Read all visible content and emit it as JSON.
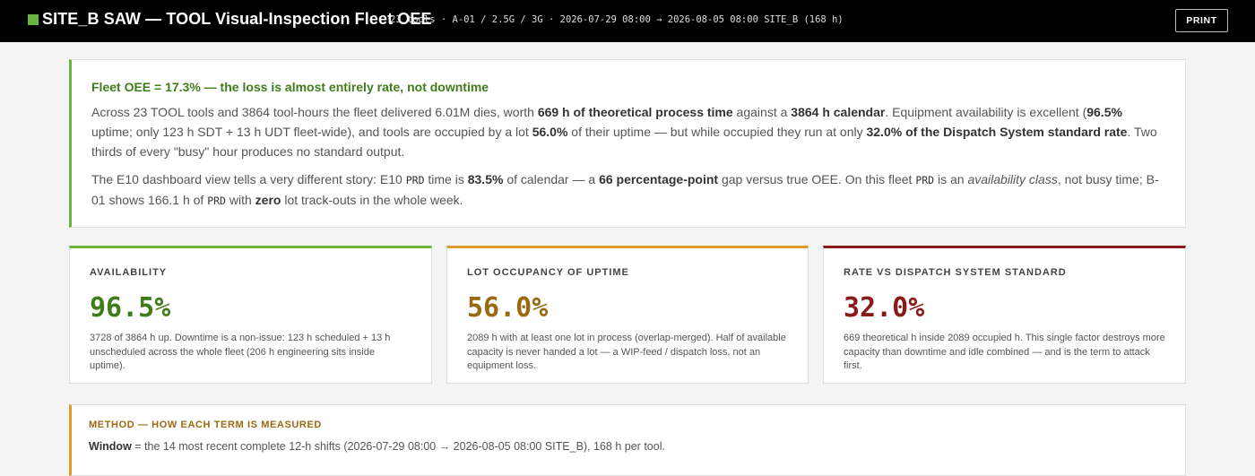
{
  "header": {
    "title": "SITE_B SAW — TOOL Visual-Inspection Fleet OEE",
    "meta": "23 tools · A-01 / 2.5G / 3G · 2026-07-29 08:00 → 2026-08-05 08:00 SITE_B (168 h)",
    "print_label": "PRINT",
    "accent": "#6db33f"
  },
  "summary": {
    "heading": "Fleet OEE = 17.3% — the loss is almost entirely rate, not downtime",
    "p1": {
      "t1": "Across 23 TOOL tools and 3864 tool-hours the fleet delivered 6.01M dies, worth ",
      "b1": "669 h of theoretical process time",
      "t2": " against a ",
      "b2": "3864 h calendar",
      "t3": ". Equipment availability is excellent (",
      "b3": "96.5%",
      "t4": " uptime; only 123 h SDT + 13 h UDT fleet-wide), and tools are occupied by a lot ",
      "b4": "56.0%",
      "t5": " of their uptime — but while occupied they run at only ",
      "b5": "32.0% of the Dispatch System standard rate",
      "t6": ". Two thirds of every \"busy\" hour produces no standard output."
    },
    "p2": {
      "t1": "The E10 dashboard view tells a very different story: E10 ",
      "c1": "PRD",
      "t2": " time is ",
      "b1": "83.5%",
      "t3": " of calendar — a ",
      "b2": "66 percentage-point",
      "t4": " gap versus true OEE. On this fleet ",
      "c2": "PRD",
      "t5": " is an ",
      "i1": "availability class",
      "t6": ", not busy time; B-01 shows 166.1 h of ",
      "c3": "PRD",
      "t7": " with ",
      "b3": "zero",
      "t8": " lot track-outs in the whole week."
    }
  },
  "cards": [
    {
      "label": "AVAILABILITY",
      "value": "96.5%",
      "desc": "3728 of 3864 h up. Downtime is a non-issue: 123 h scheduled + 13 h unscheduled across the whole fleet (206 h engineering sits inside uptime).",
      "color": "#6db33f"
    },
    {
      "label": "LOT OCCUPANCY OF UPTIME",
      "value": "56.0%",
      "desc": "2089 h with at least one lot in process (overlap-merged). Half of available capacity is never handed a lot — a WIP-feed / dispatch loss, not an equipment loss.",
      "color": "#e09c2b"
    },
    {
      "label": "RATE VS DISPATCH SYSTEM STANDARD",
      "value": "32.0%",
      "desc": "669 theoretical h inside 2089 occupied h. This single factor destroys more capacity than downtime and idle combined — and is the term to attack first.",
      "color": "#8b1a1a"
    }
  ],
  "method": {
    "heading": "METHOD — HOW EACH TERM IS MEASURED",
    "window_label": "Window",
    "window_text": " = the 14 most recent complete 12-h shifts (2026-07-29 08:00 → 2026-08-05 08:00 SITE_B), 168 h per tool."
  }
}
